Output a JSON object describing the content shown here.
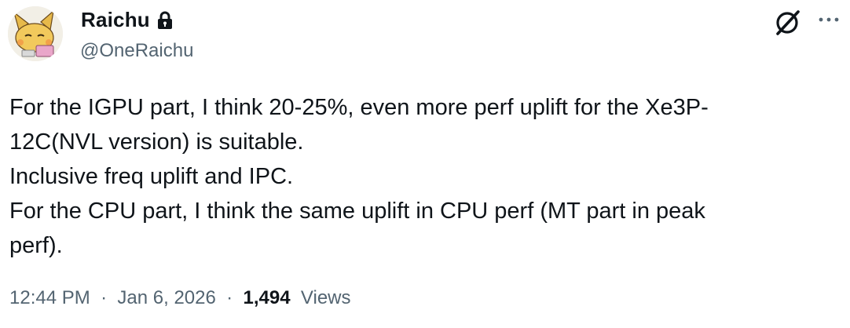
{
  "author": {
    "display_name": "Raichu",
    "handle": "@OneRaichu"
  },
  "tweet": {
    "lines": [
      "For the IGPU part, I think 20-25%, even more perf uplift for the Xe3P-",
      "12C(NVL version) is suitable.",
      "Inclusive freq uplift and IPC.",
      "For the CPU part, I think the same uplift in CPU perf (MT part in peak",
      "perf)."
    ]
  },
  "meta": {
    "time": "12:44 PM",
    "separator": "·",
    "date": "Jan 6, 2026",
    "views_count": "1,494",
    "views_label": "Views"
  },
  "icons": {
    "verified_lock": "lock-icon",
    "grok": "grok-icon",
    "more": "more-icon"
  },
  "colors": {
    "text_primary": "#0f1419",
    "text_secondary": "#536471",
    "background": "#ffffff"
  }
}
